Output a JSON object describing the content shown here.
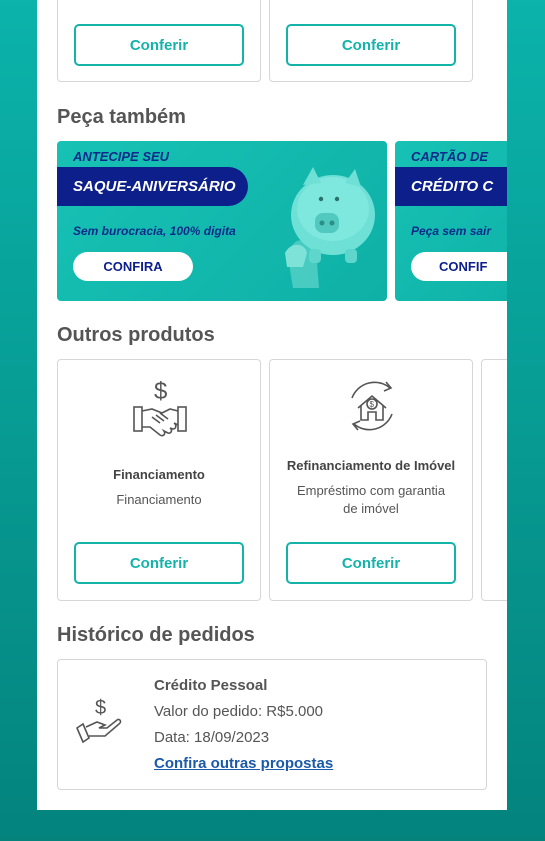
{
  "top_cards": {
    "button_label": "Conferir"
  },
  "peca_tambem": {
    "title": "Peça também",
    "banners": [
      {
        "kicker": "ANTECIPE SEU",
        "headline": "SAQUE-ANIVERSÁRIO",
        "subtitle": "Sem burocracia, 100% digita",
        "cta": "CONFIRA"
      },
      {
        "kicker": "CARTÃO DE",
        "headline": "CRÉDITO C",
        "subtitle": "Peça sem sair",
        "cta": "CONFIF"
      }
    ]
  },
  "outros_produtos": {
    "title": "Outros produtos",
    "items": [
      {
        "title": "Financiamento",
        "description": "Financiamento",
        "button": "Conferir",
        "icon": "handshake-dollar-icon"
      },
      {
        "title": "Refinanciamento de Imóvel",
        "description": "Empréstimo com garantia de imóvel",
        "button": "Conferir",
        "icon": "house-refinance-icon"
      }
    ]
  },
  "historico": {
    "title": "Histórico de pedidos",
    "order": {
      "product": "Crédito Pessoal",
      "value_line": "Valor do pedido: R$5.000",
      "date_line": "Data: 18/09/2023",
      "link": "Confira outras propostas",
      "icon": "hand-dollar-icon"
    }
  },
  "colors": {
    "accent": "#14b3aa",
    "navy": "#0c1f8a",
    "link": "#1a5aa8"
  }
}
